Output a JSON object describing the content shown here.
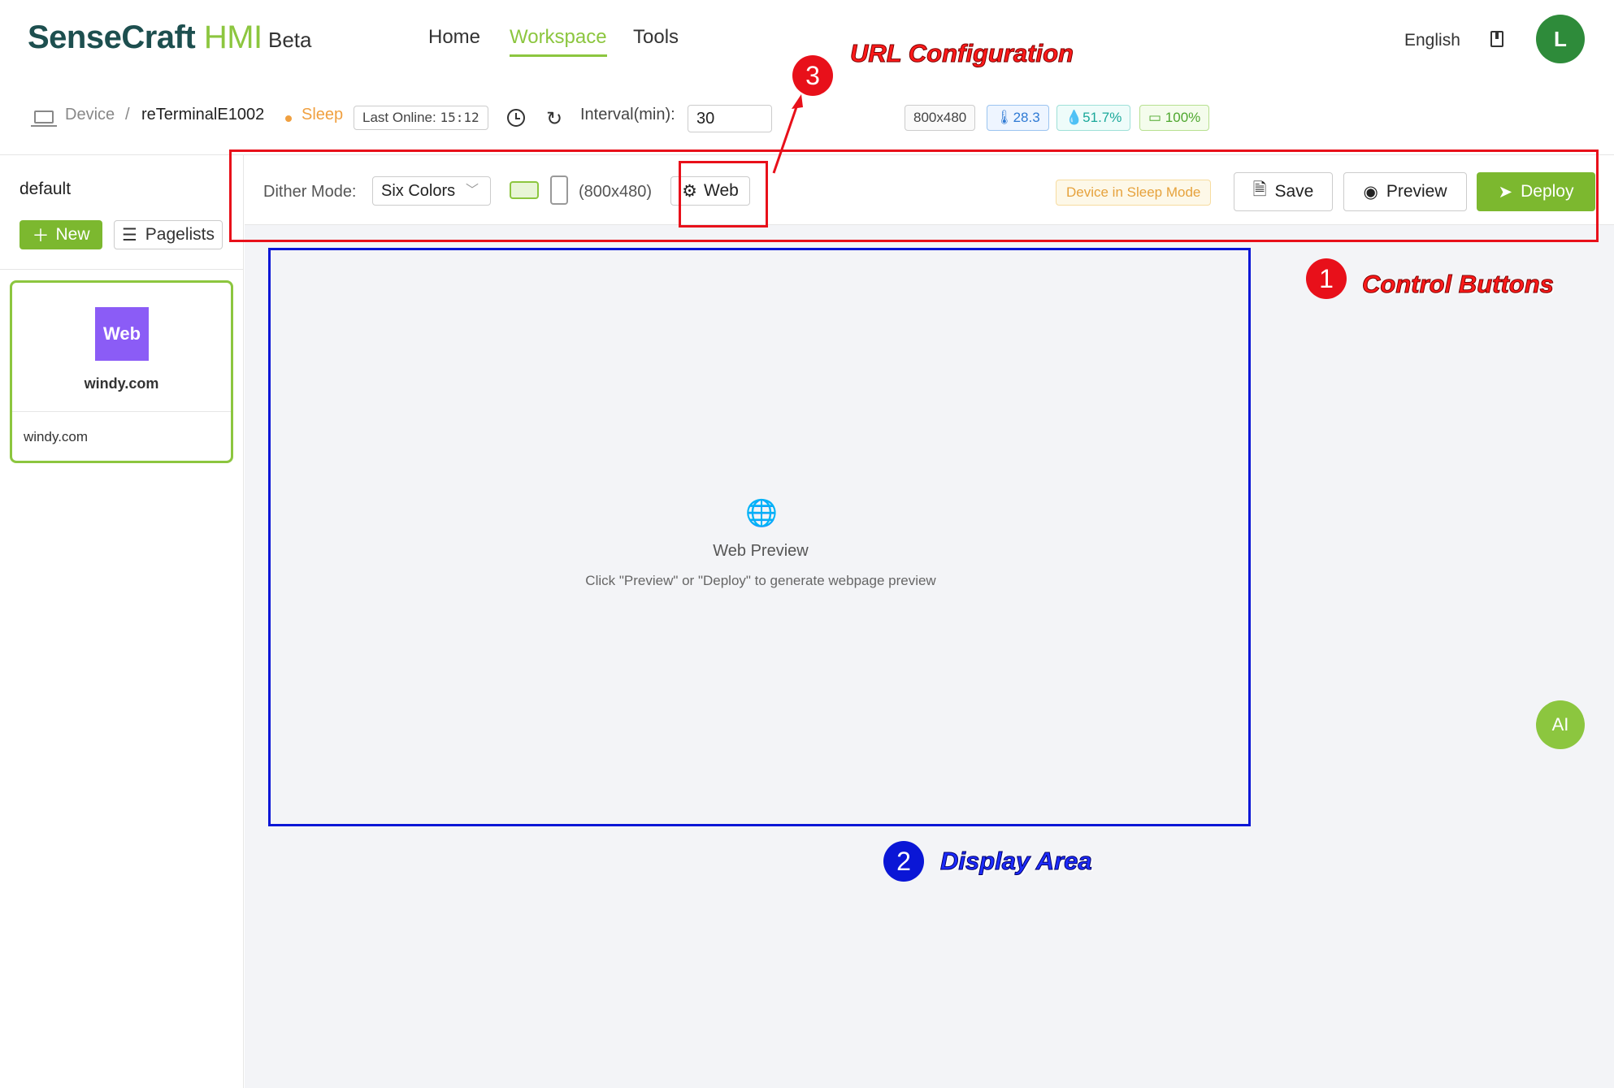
{
  "header": {
    "logo_main": "SenseCraft",
    "logo_accent": "HMI",
    "beta": "Beta",
    "nav": [
      {
        "label": "Home"
      },
      {
        "label": "Workspace",
        "active": true
      },
      {
        "label": "Tools"
      }
    ],
    "language": "English",
    "avatar_initial": "L"
  },
  "device_bar": {
    "crumb_root": "Device",
    "crumb_sep": "/",
    "device_name": "reTerminalE1002",
    "status": "Sleep",
    "last_online_label": "Last Online:",
    "last_online_time": "15:12",
    "interval_label": "Interval(min):",
    "interval_value": "30",
    "resolution_tag": "800x480",
    "temperature": "28.3",
    "humidity": "51.7%",
    "battery": "100%",
    "colors": {
      "status": "#f0a040",
      "temp": "#2f7ad4",
      "humidity": "#1aa89a",
      "battery": "#4ea72e"
    }
  },
  "sidebar": {
    "title": "default",
    "new_label": "New",
    "pagelists_label": "Pagelists",
    "cards": [
      {
        "thumb_text": "Web",
        "domain": "windy.com",
        "name": "windy.com"
      }
    ]
  },
  "toolbar": {
    "dither_label": "Dither Mode:",
    "dither_value": "Six Colors",
    "resolution": "(800x480)",
    "web_label": "Web",
    "sleep_badge": "Device in Sleep Mode",
    "save_label": "Save",
    "preview_label": "Preview",
    "deploy_label": "Deploy"
  },
  "display": {
    "title": "Web Preview",
    "subtitle": "Click \"Preview\" or \"Deploy\" to generate webpage preview"
  },
  "ai_button": "AI",
  "annotations": {
    "one": {
      "number": "1",
      "label": "Control Buttons"
    },
    "two": {
      "number": "2",
      "label": "Display Area"
    },
    "three": {
      "number": "3",
      "label": "URL Configuration"
    }
  },
  "theme": {
    "accent": "#8cc63f",
    "brand_dark": "#1d4f4f",
    "annotation_red": "#e8101a",
    "annotation_blue": "#0a16d6"
  }
}
